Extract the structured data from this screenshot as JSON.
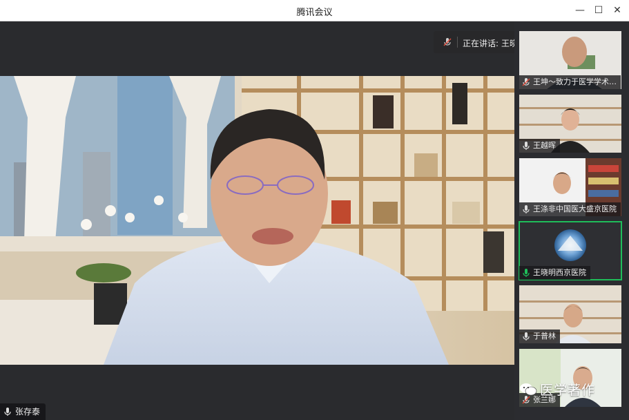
{
  "window": {
    "title": "腾讯会议",
    "minimize_label": "—",
    "maximize_label": "☐",
    "close_label": "✕"
  },
  "speaking": {
    "label": "正在讲话:",
    "speaker": "王晓明西京医院;"
  },
  "main_participant": {
    "name": "张存泰"
  },
  "participants": [
    {
      "name": "王坤～致力于医学学术…",
      "mic": "muted"
    },
    {
      "name": "王越晖",
      "mic": "on"
    },
    {
      "name": "王涤非中国医大盛京医院",
      "mic": "on"
    },
    {
      "name": "王晓明西京医院",
      "mic": "speaking"
    },
    {
      "name": "于普林",
      "mic": "on"
    },
    {
      "name": "张兰娜",
      "mic": "muted"
    }
  ],
  "watermark": {
    "text": "医学著作"
  },
  "colors": {
    "accent_green": "#1fbd5a",
    "muted_red": "#e04a3a"
  }
}
